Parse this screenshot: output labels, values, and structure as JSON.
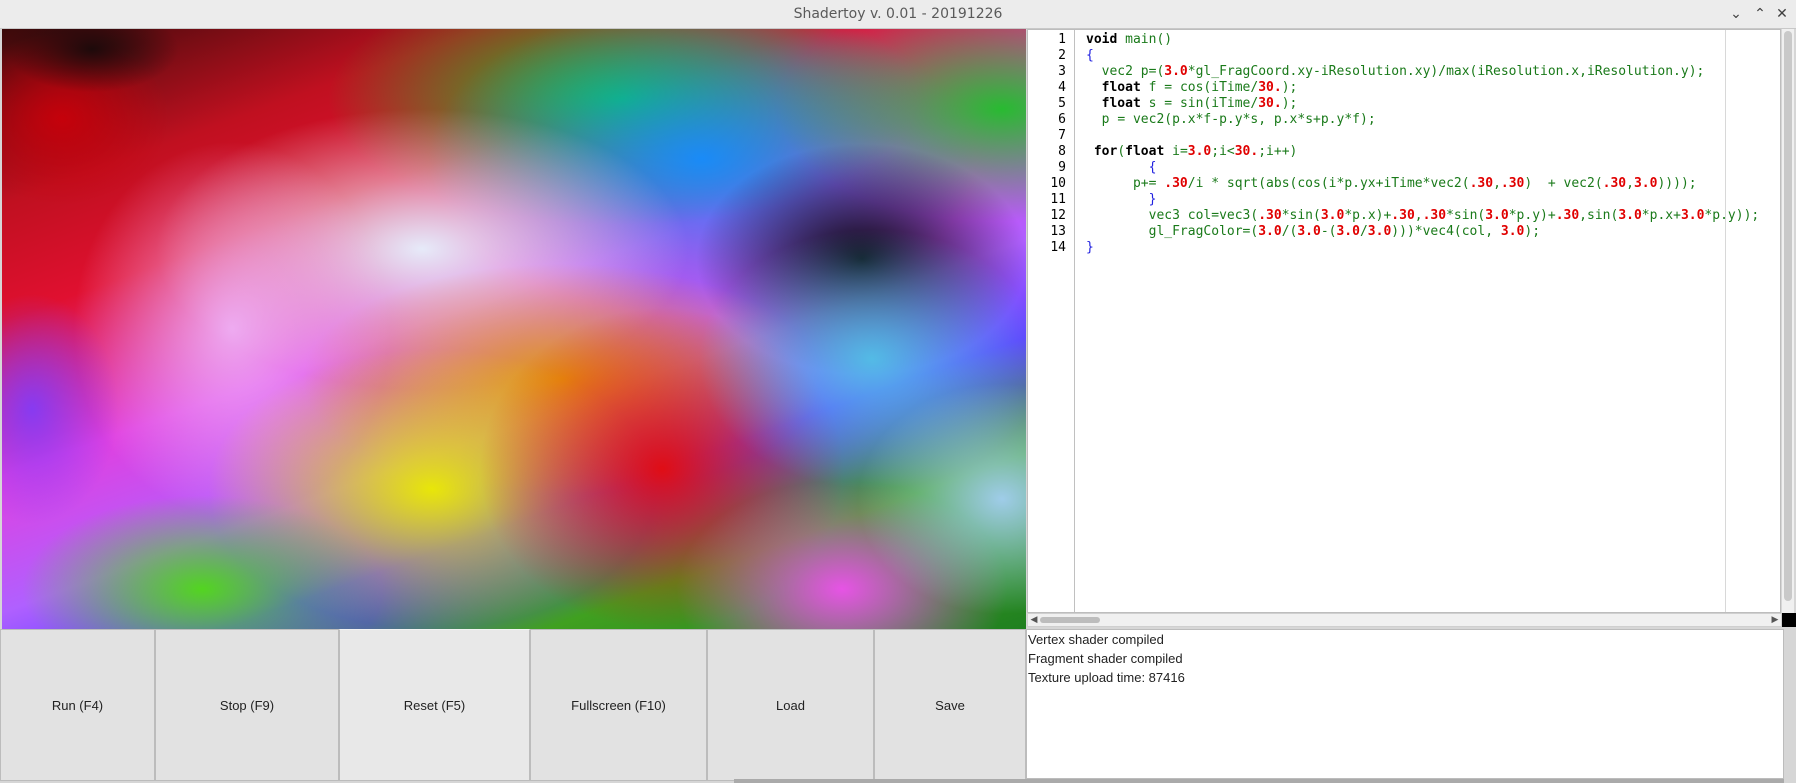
{
  "window": {
    "title": "Shadertoy v. 0.01 - 20191226",
    "controls": [
      "chevron-down-icon",
      "chevron-up-icon",
      "close-icon"
    ],
    "minimize_glyph": "⌄",
    "maximize_glyph": "⌃",
    "close_glyph": "✕"
  },
  "editor": {
    "line_numbers": [
      "1",
      "2",
      "3",
      "4",
      "5",
      "6",
      "7",
      "8",
      "9",
      "10",
      "11",
      "12",
      "13",
      "14"
    ],
    "code_lines": [
      "void main()",
      "{",
      "  vec2 p=(3.0*gl_FragCoord.xy-iResolution.xy)/max(iResolution.x,iResolution.y);",
      "  float f = cos(iTime/30.);",
      "  float s = sin(iTime/30.);",
      "  p = vec2(p.x*f-p.y*s, p.x*s+p.y*f);",
      "",
      " for(float i=3.0;i<30.;i++)",
      "        {",
      "      p+= .30/i * sqrt(abs(cos(i*p.yx+iTime*vec2(.30,.30)  + vec2(.30,3.0))));",
      "        }",
      "        vec3 col=vec3(.30*sin(3.0*p.x)+.30,.30*sin(3.0*p.y)+.30,sin(3.0*p.x+3.0*p.y));",
      "        gl_FragColor=(3.0/(3.0-(3.0/3.0)))*vec4(col, 3.0);",
      "}"
    ]
  },
  "buttons": {
    "run": "Run (F4)",
    "stop": "Stop (F9)",
    "reset": "Reset (F5)",
    "fullscreen": "Fullscreen (F10)",
    "load": "Load",
    "save": "Save"
  },
  "log": [
    "Vertex shader compiled",
    "Fragment shader compiled",
    "Texture upload time: 87416"
  ],
  "colors": {
    "keyword": "#000000",
    "number": "#e00000",
    "code": "#1a7a1a",
    "brace": "#2020e0"
  }
}
